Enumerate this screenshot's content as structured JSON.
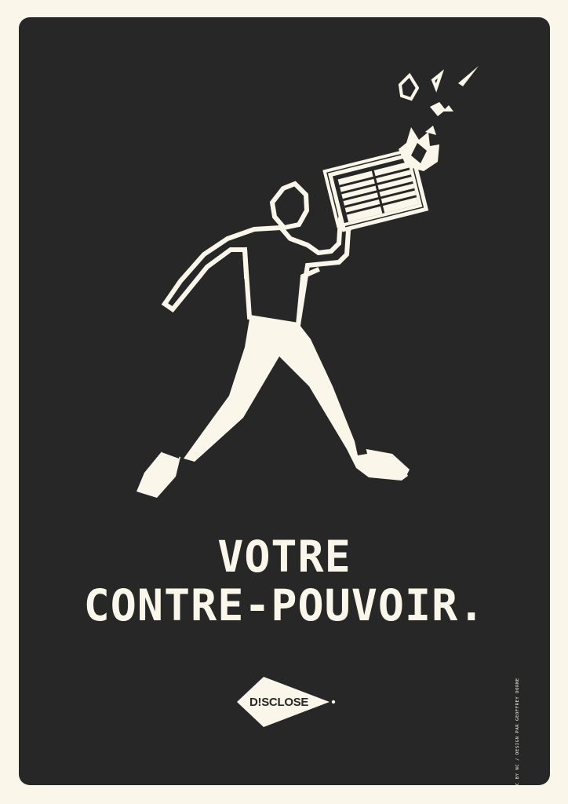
{
  "poster": {
    "headline_line1": "VOTRE",
    "headline_line2": "CONTRE-POUVOIR.",
    "logo_text": "D!SCLOSE",
    "credit": "CC BY NC / DESIGN PAR GEOFFREY DORNE"
  },
  "colors": {
    "background": "#272727",
    "foreground": "#faf7ea"
  },
  "icons": {
    "illustration": "newspaper-thrower-figure-icon",
    "logo": "disclose-arrowhead-logo-icon"
  }
}
